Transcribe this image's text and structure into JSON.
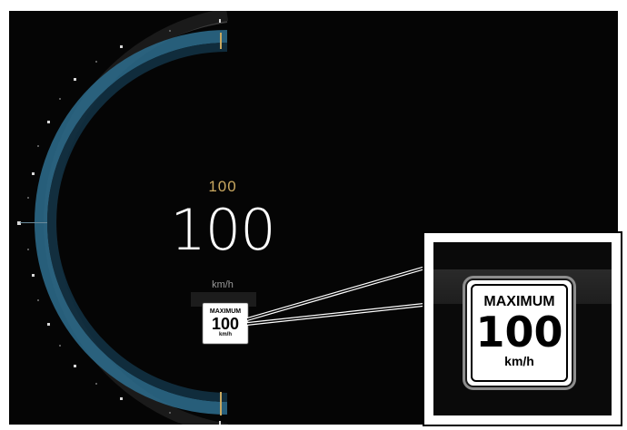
{
  "cluster": {
    "set_speed": "100",
    "current_speed": "100",
    "speed_unit": "km/h"
  },
  "traffic_sign": {
    "type_label": "MAXIMUM",
    "limit_value": "100",
    "unit": "km/h"
  },
  "colors": {
    "background": "#050505",
    "dial_arc": "#2e6f8f",
    "set_speed_accent": "#c9a860",
    "speed_text": "#ffffff"
  },
  "icons": [
    "speed-limit-sign-icon",
    "speed-limit-sign-magnified-icon"
  ]
}
